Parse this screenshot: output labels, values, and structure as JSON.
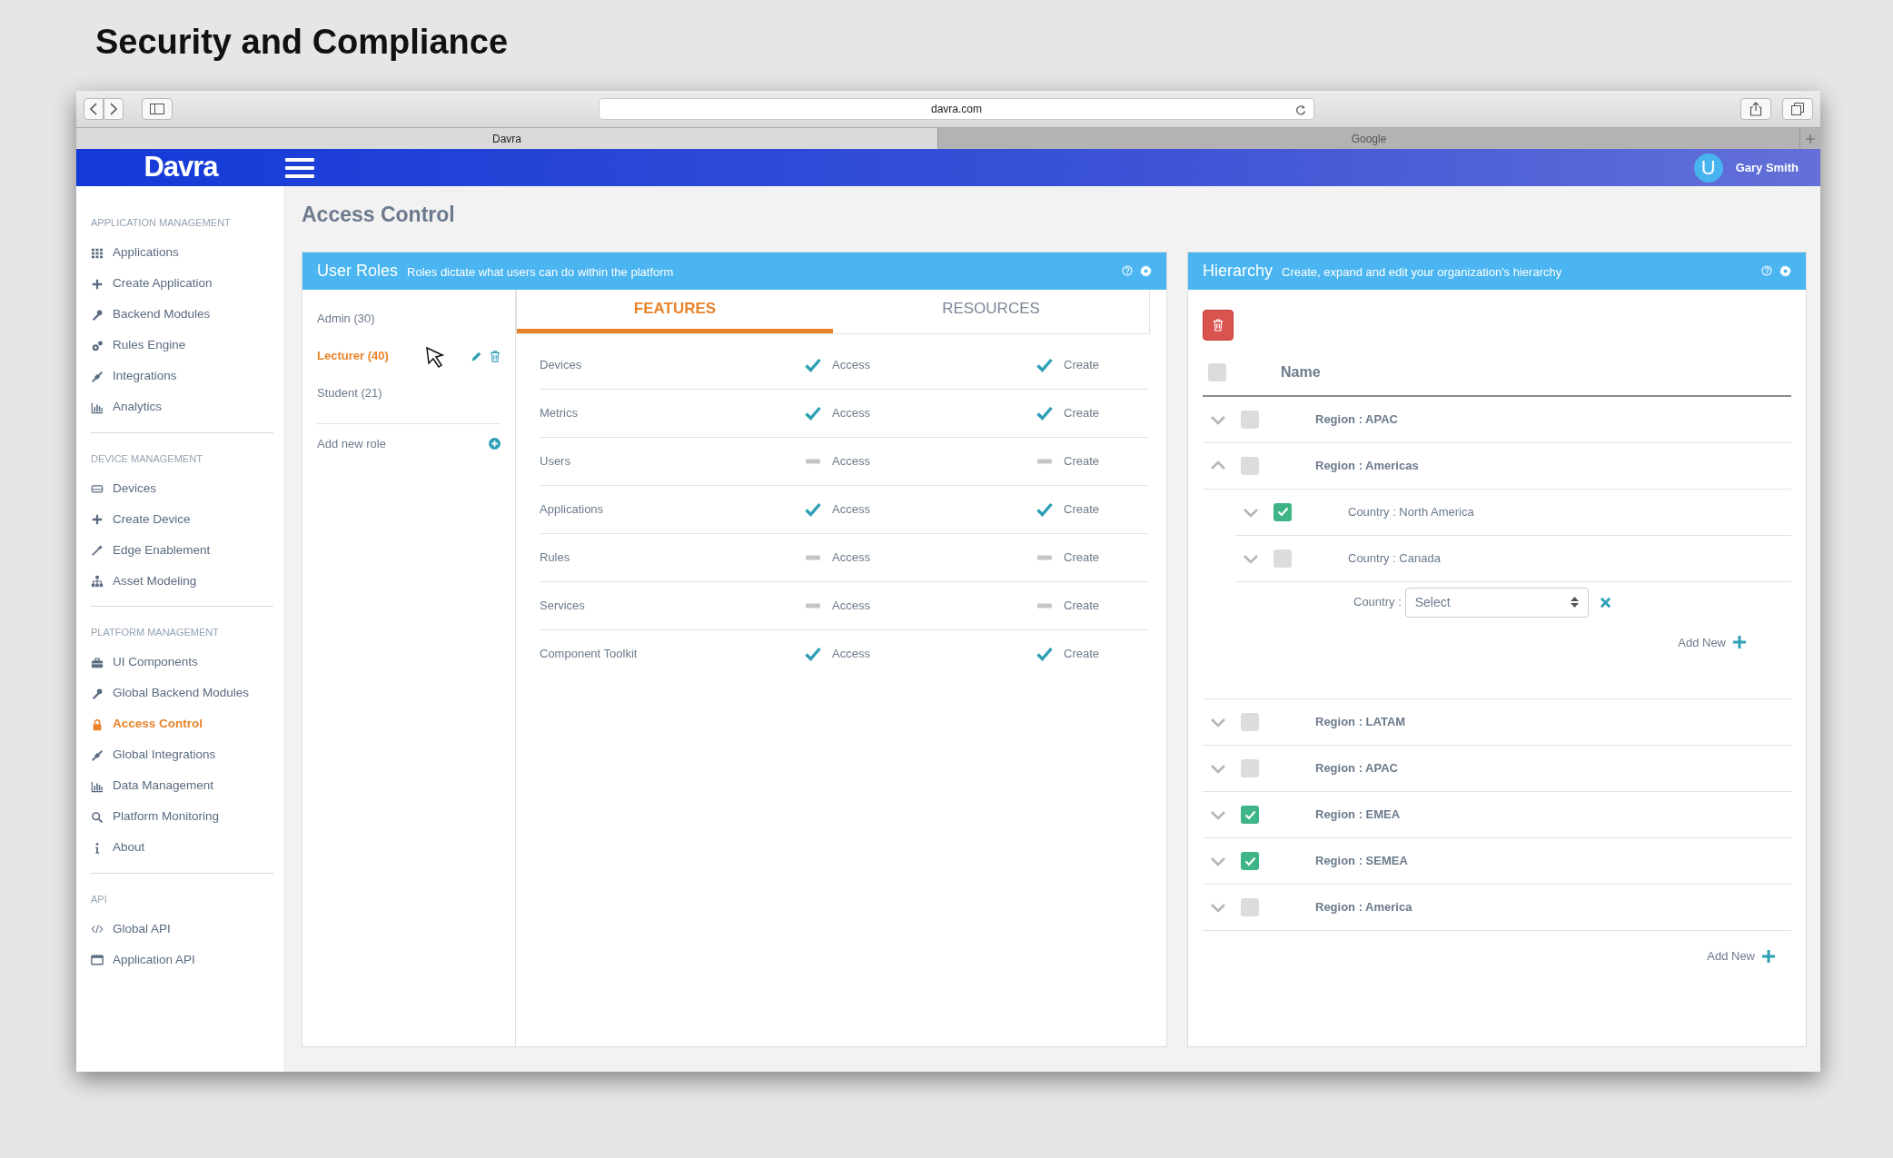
{
  "page_title": "Security and Compliance",
  "browser": {
    "url": "davra.com",
    "tabs": [
      {
        "label": "Davra",
        "selected": true
      },
      {
        "label": "Google",
        "selected": false
      }
    ]
  },
  "app_header": {
    "logo": "Davra",
    "user": {
      "initial": "U",
      "name": "Gary Smith"
    }
  },
  "sidebar": {
    "sections": [
      {
        "title": "APPLICATION MANAGEMENT",
        "items": [
          {
            "label": "Applications",
            "selected": false
          },
          {
            "label": "Create Application",
            "selected": false
          },
          {
            "label": "Backend Modules",
            "selected": false
          },
          {
            "label": "Rules Engine",
            "selected": false
          },
          {
            "label": "Integrations",
            "selected": false
          },
          {
            "label": "Analytics",
            "selected": false
          }
        ]
      },
      {
        "title": "DEVICE MANAGEMENT",
        "items": [
          {
            "label": "Devices",
            "selected": false
          },
          {
            "label": "Create Device",
            "selected": false
          },
          {
            "label": "Edge Enablement",
            "selected": false
          },
          {
            "label": "Asset Modeling",
            "selected": false
          }
        ]
      },
      {
        "title": "PLATFORM MANAGEMENT",
        "items": [
          {
            "label": "UI Components",
            "selected": false
          },
          {
            "label": "Global Backend Modules",
            "selected": false
          },
          {
            "label": "Access Control",
            "selected": true
          },
          {
            "label": "Global Integrations",
            "selected": false
          },
          {
            "label": "Data Management",
            "selected": false
          },
          {
            "label": "Platform Monitoring",
            "selected": false
          },
          {
            "label": "About",
            "selected": false
          }
        ]
      },
      {
        "title": "API",
        "items": [
          {
            "label": "Global API",
            "selected": false
          },
          {
            "label": "Application API",
            "selected": false
          }
        ]
      }
    ]
  },
  "page_heading": "Access Control",
  "user_roles": {
    "title": "User Roles",
    "subtitle": "Roles dictate what users can do within the platform",
    "roles": [
      {
        "label": "Admin (30)",
        "selected": false
      },
      {
        "label": "Lecturer (40)",
        "selected": true
      },
      {
        "label": "Student (21)",
        "selected": false
      }
    ],
    "add_role": "Add new role",
    "tabs": [
      {
        "label": "FEATURES",
        "selected": true
      },
      {
        "label": "RESOURCES",
        "selected": false
      }
    ],
    "features": [
      {
        "name": "Devices",
        "access": true,
        "access_label": "Access",
        "create": true,
        "create_label": "Create"
      },
      {
        "name": "Metrics",
        "access": true,
        "access_label": "Access",
        "create": true,
        "create_label": "Create"
      },
      {
        "name": "Users",
        "access": false,
        "access_label": "Access",
        "create": false,
        "create_label": "Create"
      },
      {
        "name": "Applications",
        "access": true,
        "access_label": "Access",
        "create": true,
        "create_label": "Create"
      },
      {
        "name": "Rules",
        "access": false,
        "access_label": "Access",
        "create": false,
        "create_label": "Create"
      },
      {
        "name": "Services",
        "access": false,
        "access_label": "Access",
        "create": false,
        "create_label": "Create"
      },
      {
        "name": "Component Toolkit",
        "access": true,
        "access_label": "Access",
        "create": true,
        "create_label": "Create"
      }
    ]
  },
  "hierarchy": {
    "title": "Hierarchy",
    "subtitle": "Create, expand and edit your organization's hierarchy",
    "header_checked": false,
    "column": "Name",
    "rows": [
      {
        "label": "Region : APAC",
        "expanded": false,
        "checked": false
      },
      {
        "label": "Region : Americas",
        "expanded": true,
        "checked": false,
        "children": [
          {
            "label": "Country : North America",
            "expanded": false,
            "checked": true
          },
          {
            "label": "Country : Canada",
            "expanded": false,
            "checked": false
          }
        ],
        "add_form": {
          "label": "Country :",
          "select": "Select",
          "add_label": "Add New"
        }
      },
      {
        "label": "Region : LATAM",
        "expanded": false,
        "checked": false
      },
      {
        "label": "Region : APAC",
        "expanded": false,
        "checked": false
      },
      {
        "label": "Region : EMEA",
        "expanded": false,
        "checked": true
      },
      {
        "label": "Region : SEMEA",
        "expanded": false,
        "checked": true
      },
      {
        "label": "Region : America",
        "expanded": false,
        "checked": false
      }
    ],
    "add_label": "Add New"
  }
}
